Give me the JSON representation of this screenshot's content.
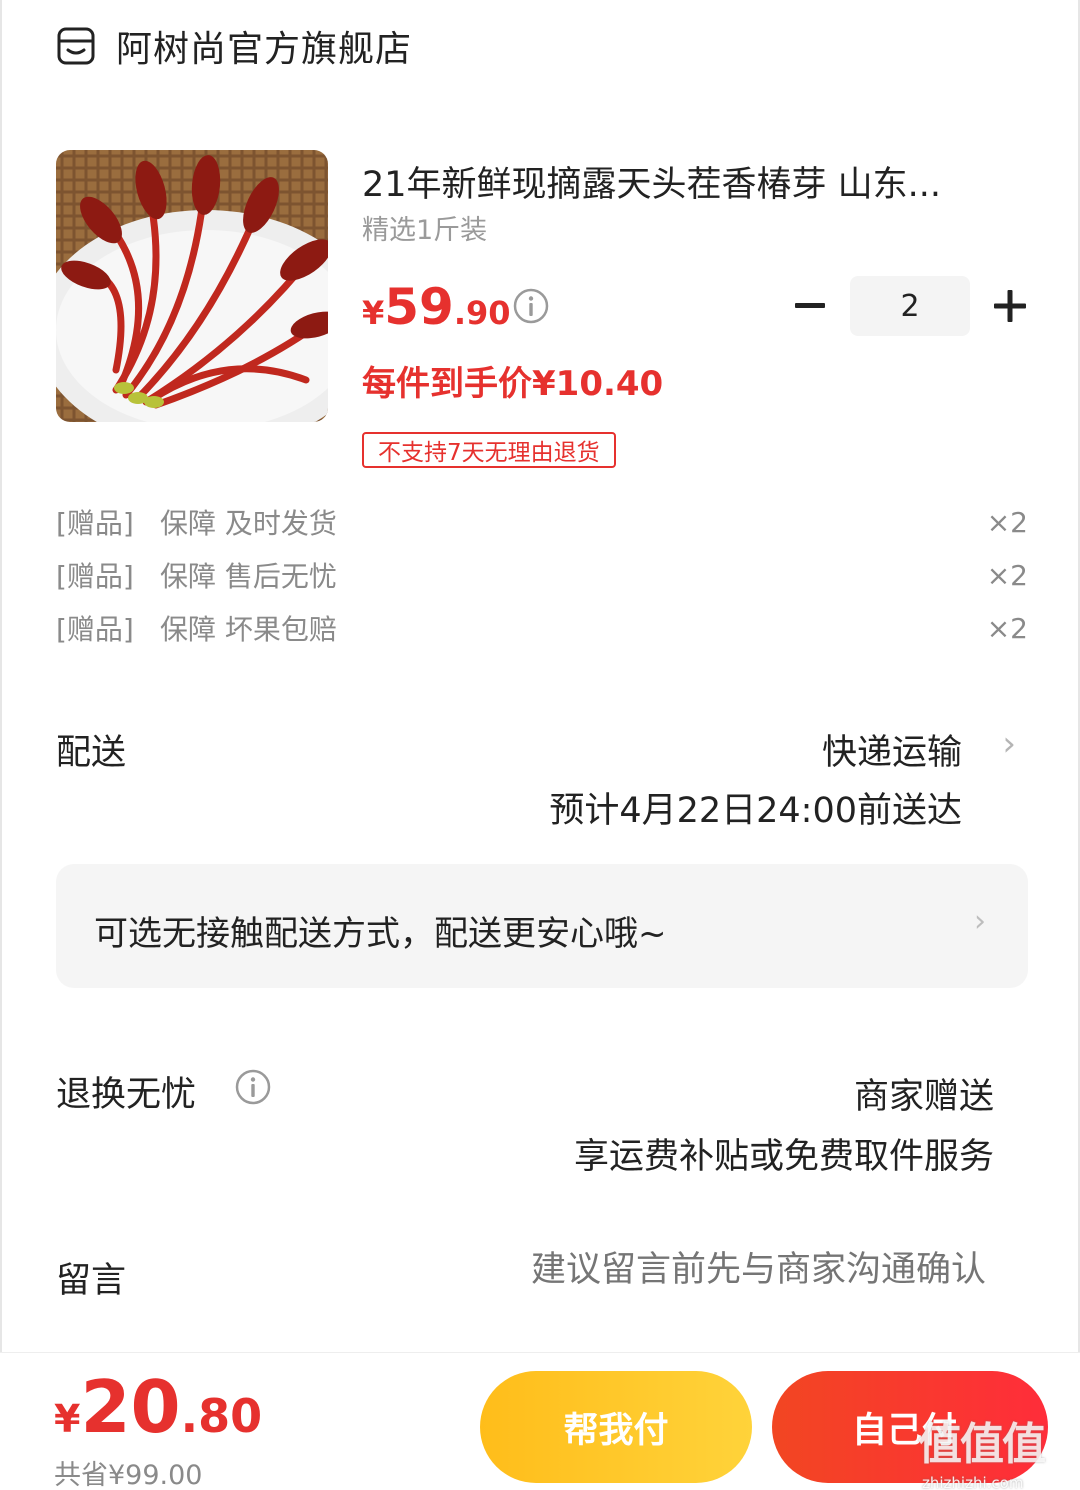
{
  "shop": {
    "icon": "shop-icon",
    "name": "阿树尚官方旗舰店"
  },
  "product": {
    "image_icon": "toona-sprout-photo",
    "title": "21年新鲜现摘露天头茬香椿芽 山东...",
    "spec": "精选1斤装",
    "price_symbol": "¥",
    "price_integer": "59",
    "price_decimal": ".90",
    "quantity": "2",
    "unit_price": "每件到手价¥10.40",
    "return_tag": "不支持7天无理由退货"
  },
  "gifts": [
    {
      "tag": "[赠品]",
      "name": "保障 及时发货",
      "qty": "×2"
    },
    {
      "tag": "[赠品]",
      "name": "保障 售后无忧",
      "qty": "×2"
    },
    {
      "tag": "[赠品]",
      "name": "保障 坏果包赔",
      "qty": "×2"
    }
  ],
  "delivery": {
    "label": "配送",
    "method": "快递运输",
    "eta": "预计4月22日24:00前送达",
    "notice": "可选无接触配送方式，配送更安心哦~"
  },
  "worry_free": {
    "label": "退换无忧",
    "value": "商家赠送",
    "sub": "享运费补贴或免费取件服务"
  },
  "message": {
    "label": "留言",
    "placeholder": "建议留言前先与商家沟通确认"
  },
  "footer": {
    "total_symbol": "¥",
    "total_integer": "20",
    "total_decimal": ".80",
    "saved": "共省¥99.00",
    "help_pay": "帮我付",
    "self_pay": "自己付"
  },
  "watermark": {
    "glyphs": "值值值",
    "url": "zhizhizhi.com"
  },
  "colors": {
    "accent_red": "#e6312e",
    "help_button": "#ffc423",
    "pay_button": "#f5332a"
  }
}
